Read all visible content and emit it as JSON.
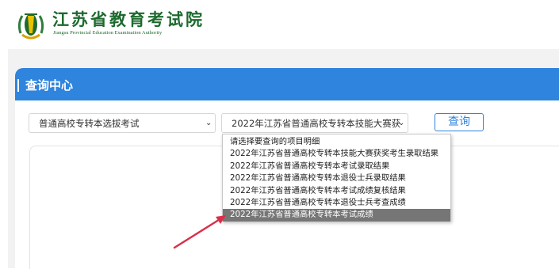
{
  "header": {
    "brand_cn": "江苏省教育考试院",
    "brand_en": "Jiangsu Provincial Education Examination Authority"
  },
  "panel": {
    "title": "查询中心"
  },
  "filters": {
    "exam_type": "普通高校专转本选拔考试",
    "project": "2022年江苏省普通高校专转本技能大赛获",
    "query_button": "查询"
  },
  "dropdown": {
    "options": [
      "请选择要查询的项目明细",
      "2022年江苏省普通高校专转本技能大赛获奖考生录取结果",
      "2022年江苏省普通高校专转本考试录取结果",
      "2022年江苏省普通高校专转本退役士兵录取结果",
      "2022年江苏省普通高校专转本考试成绩复核结果",
      "2022年江苏省普通高校专转本退役士兵考查成绩",
      "2022年江苏省普通高校专转本考试成绩"
    ],
    "highlighted_index": 6
  },
  "colors": {
    "brand_green": "#1d6a2f",
    "accent_blue": "#2f84dd",
    "annotation_arrow": "#d9304a"
  }
}
